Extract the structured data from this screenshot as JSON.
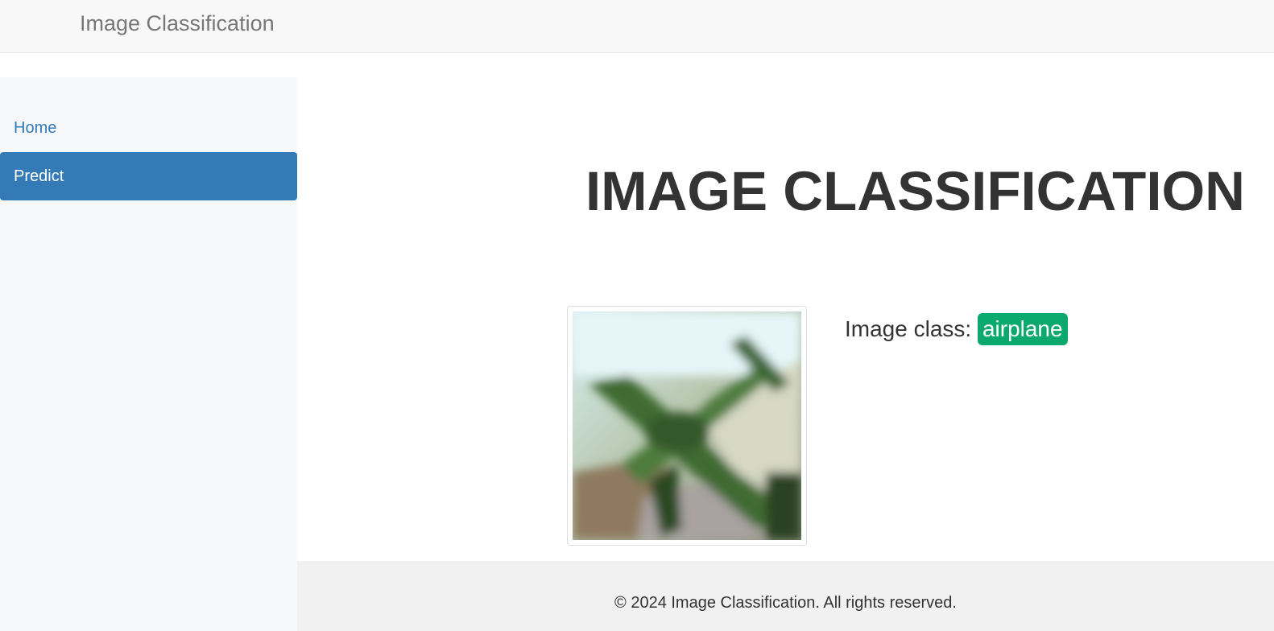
{
  "navbar": {
    "brand": "Image Classification"
  },
  "sidebar": {
    "items": [
      {
        "label": "Home",
        "active": false
      },
      {
        "label": "Predict",
        "active": true
      }
    ]
  },
  "main": {
    "heading": "IMAGE CLASSIFICATION",
    "result_label": "Image class:",
    "result_value": "airplane",
    "result_color": "#0ca96f"
  },
  "footer": {
    "text": "© 2024 Image Classification. All rights reserved."
  },
  "colors": {
    "accent": "#337ab7",
    "navbar_bg": "#f8f8f8",
    "sidebar_bg": "#f7f8fa",
    "footer_bg": "#f1f1f1"
  }
}
